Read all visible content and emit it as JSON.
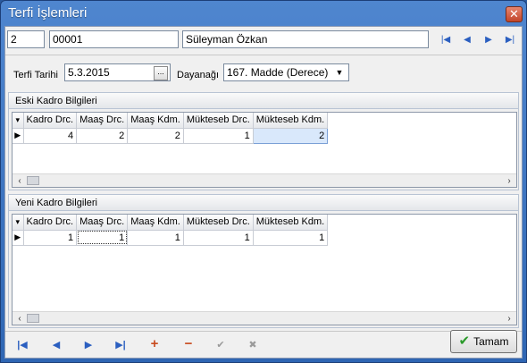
{
  "window": {
    "title": "Terfi İşlemleri"
  },
  "header": {
    "code": "2",
    "number": "00001",
    "name": "Süleyman Özkan",
    "nav": [
      "first",
      "prev",
      "next",
      "last"
    ]
  },
  "form": {
    "terfi_label": "Terfi Tarihi",
    "terfi_value": "5.3.2015",
    "date_button": "...",
    "dayanak_label": "Dayanağı",
    "dayanak_value": "167. Madde (Derece)"
  },
  "old_group": {
    "title": "Eski Kadro Bilgileri",
    "columns": [
      "Kadro Drc.",
      "Maaş Drc.",
      "Maaş Kdm.",
      "Mükteseb Drc.",
      "Mükteseb Kdm."
    ],
    "row": [
      "4",
      "2",
      "2",
      "1",
      "2"
    ]
  },
  "new_group": {
    "title": "Yeni Kadro Bilgileri",
    "columns": [
      "Kadro Drc.",
      "Maaş Drc.",
      "Maaş Kdm.",
      "Mükteseb Drc.",
      "Mükteseb Kdm."
    ],
    "row": [
      "1",
      "1",
      "1",
      "1",
      "1"
    ]
  },
  "footer": {
    "ok_label": "Tamam",
    "colors": {
      "accent_red": "#c84b1f",
      "nav_blue": "#2b5fc0",
      "ok_green": "#2a9a2a"
    }
  }
}
